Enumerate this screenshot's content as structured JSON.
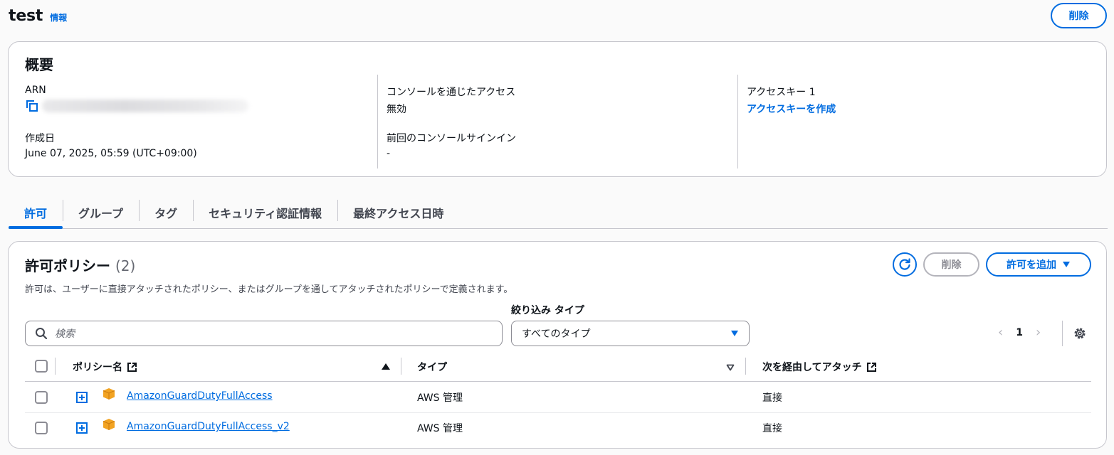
{
  "header": {
    "title": "test",
    "info": "情報",
    "delete_label": "削除"
  },
  "overview": {
    "title": "概要",
    "arn_label": "ARN",
    "created_label": "作成日",
    "created_value": "June 07, 2025, 05:59 (UTC+09:00)",
    "console_access_label": "コンソールを通じたアクセス",
    "console_access_value": "無効",
    "last_signin_label": "前回のコンソールサインイン",
    "last_signin_value": "-",
    "access_key_label": "アクセスキー 1",
    "create_access_key": "アクセスキーを作成"
  },
  "tabs": [
    {
      "label": "許可"
    },
    {
      "label": "グループ"
    },
    {
      "label": "タグ"
    },
    {
      "label": "セキュリティ認証情報"
    },
    {
      "label": "最終アクセス日時"
    }
  ],
  "permissions": {
    "title": "許可ポリシー",
    "count": "(2)",
    "description": "許可は、ユーザーに直接アタッチされたポリシー、またはグループを通してアタッチされたポリシーで定義されます。",
    "delete_label": "削除",
    "add_label": "許可を追加",
    "filter_label": "絞り込み タイプ",
    "search_placeholder": "検索",
    "filter_value": "すべてのタイプ",
    "page": "1",
    "columns": {
      "policy_name": "ポリシー名",
      "type": "タイプ",
      "attached_via": "次を経由してアタッチ"
    },
    "rows": [
      {
        "name": "AmazonGuardDutyFullAccess",
        "type": "AWS 管理",
        "via": "直接"
      },
      {
        "name": "AmazonGuardDutyFullAccess_v2",
        "type": "AWS 管理",
        "via": "直接"
      }
    ]
  },
  "colors": {
    "accent": "#006ce0",
    "border": "#c6c6cd",
    "cube": "#f2a322"
  }
}
